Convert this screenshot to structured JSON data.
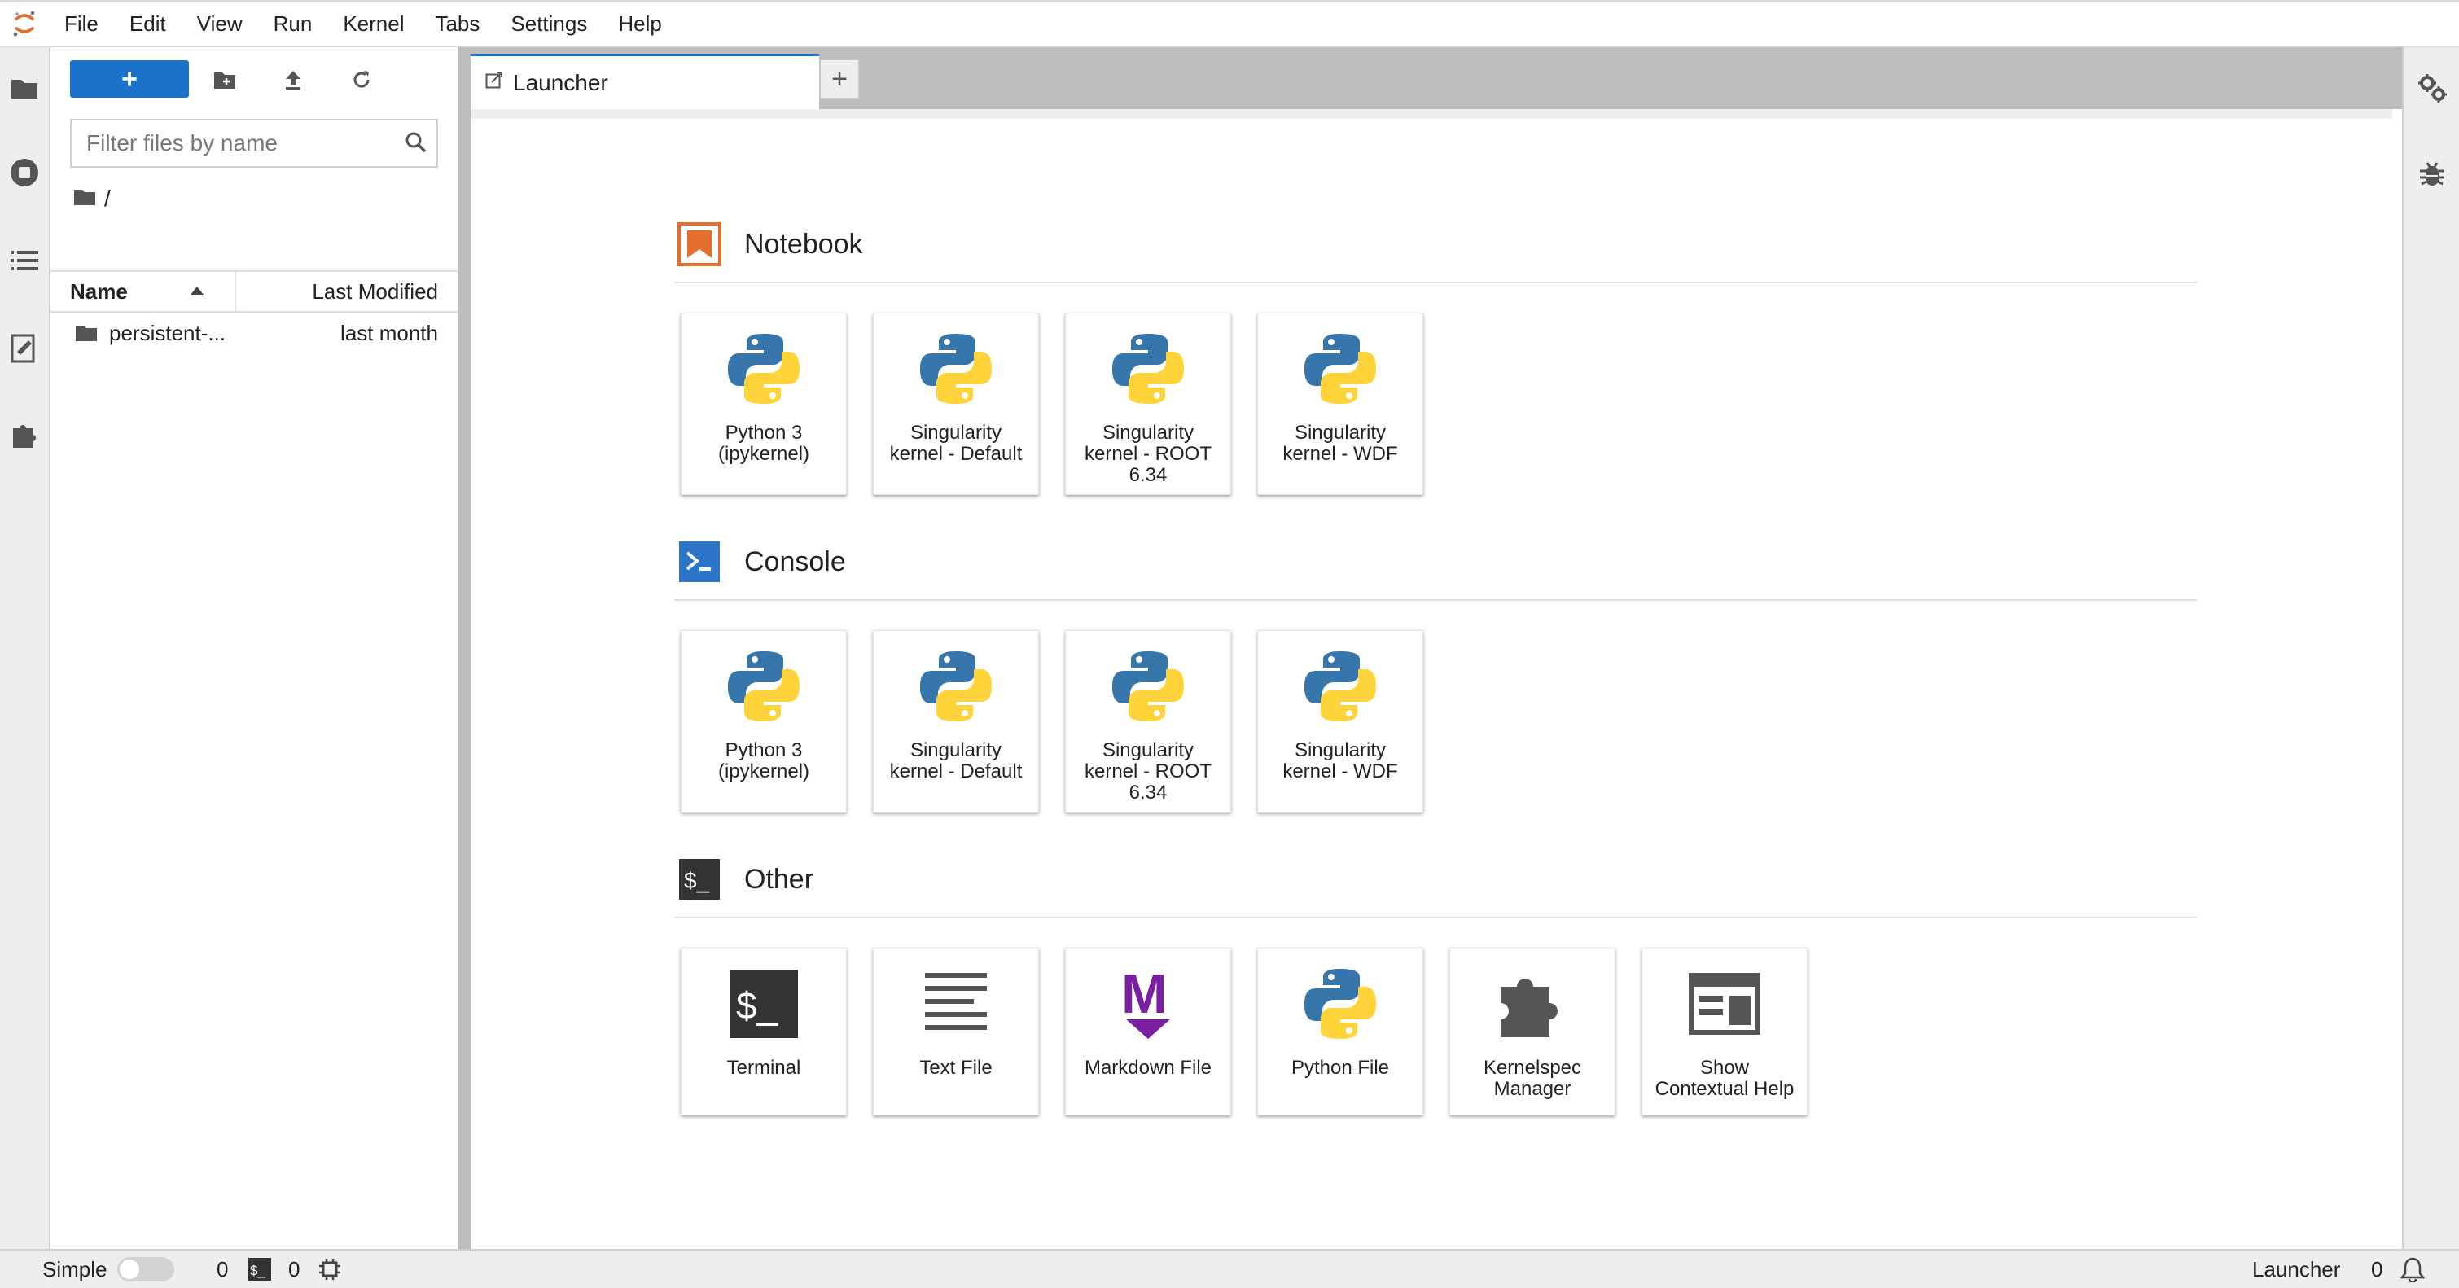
{
  "menubar": {
    "logo_icon": "jupyter-logo-icon",
    "items": [
      "File",
      "Edit",
      "View",
      "Run",
      "Kernel",
      "Tabs",
      "Settings",
      "Help"
    ]
  },
  "left_sidebar": {
    "icons": [
      "folder-icon",
      "running-stop-icon",
      "table-of-contents-icon",
      "property-inspector-icon",
      "extension-puzzle-icon"
    ]
  },
  "file_browser": {
    "new_button_label": "+",
    "toolbar_icons": [
      "new-folder-icon",
      "upload-icon",
      "refresh-icon"
    ],
    "filter_placeholder": "Filter files by name",
    "breadcrumb": "/",
    "columns": {
      "name": "Name",
      "last_modified": "Last Modified"
    },
    "rows": [
      {
        "name": "persistent-...",
        "modified": "last month"
      }
    ]
  },
  "tabs": {
    "items": [
      {
        "label": "Launcher"
      }
    ],
    "add_label": "+"
  },
  "launcher": {
    "sections": [
      {
        "title": "Notebook",
        "icon": "notebook-icon",
        "cards": [
          {
            "label": "Python 3\n(ipykernel)",
            "icon": "python-logo-icon"
          },
          {
            "label": "Singularity\nkernel - Default",
            "icon": "python-logo-icon"
          },
          {
            "label": "Singularity\nkernel - ROOT\n6.34",
            "icon": "python-logo-icon"
          },
          {
            "label": "Singularity\nkernel - WDF",
            "icon": "python-logo-icon"
          }
        ]
      },
      {
        "title": "Console",
        "icon": "console-icon",
        "cards": [
          {
            "label": "Python 3\n(ipykernel)",
            "icon": "python-logo-icon"
          },
          {
            "label": "Singularity\nkernel - Default",
            "icon": "python-logo-icon"
          },
          {
            "label": "Singularity\nkernel - ROOT\n6.34",
            "icon": "python-logo-icon"
          },
          {
            "label": "Singularity\nkernel - WDF",
            "icon": "python-logo-icon"
          }
        ]
      },
      {
        "title": "Other",
        "icon": "terminal-icon",
        "cards": [
          {
            "label": "Terminal",
            "icon": "terminal-icon"
          },
          {
            "label": "Text File",
            "icon": "text-file-icon"
          },
          {
            "label": "Markdown File",
            "icon": "markdown-icon"
          },
          {
            "label": "Python File",
            "icon": "python-logo-icon"
          },
          {
            "label": "Kernelspec\nManager",
            "icon": "puzzle-icon"
          },
          {
            "label": "Show\nContextual Help",
            "icon": "contextual-help-icon"
          }
        ]
      }
    ]
  },
  "right_sidebar": {
    "icons": [
      "property-gears-icon",
      "debugger-bug-icon"
    ]
  },
  "statusbar": {
    "mode_label": "Simple",
    "simple_mode_on": false,
    "terminals_count": "0",
    "kernels_count": "0",
    "active_label": "Launcher",
    "notifications_count": "0"
  },
  "colors": {
    "accent_blue": "#1a73c8",
    "notebook_orange": "#e46e2e",
    "console_blue": "#2c74c8",
    "markdown_purple": "#7b1fa2",
    "python_blue": "#3776ab",
    "python_yellow": "#ffd43b"
  }
}
